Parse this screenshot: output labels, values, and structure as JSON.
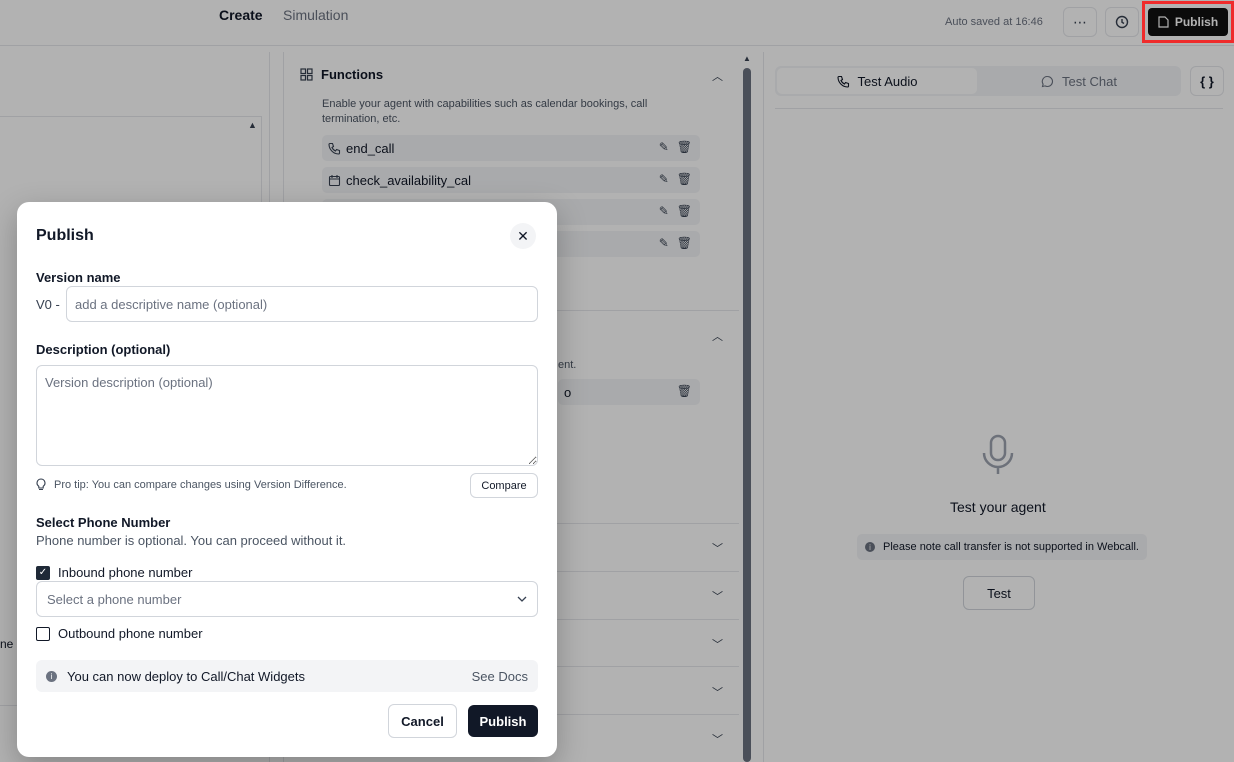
{
  "topbar": {
    "tab_create": "Create",
    "tab_simulation": "Simulation",
    "autosave": "Auto saved at 16:46",
    "more_icon": "ellipsis-icon",
    "history_icon": "history-icon",
    "publish_label": "Publish"
  },
  "left": {
    "fragment": "ne `"
  },
  "functions": {
    "title": "Functions",
    "description": "Enable your agent with capabilities such as calendar bookings, call termination, etc.",
    "items": [
      {
        "label": "end_call",
        "icon": "phone-icon"
      },
      {
        "label": "check_availability_cal",
        "icon": "calendar-icon"
      },
      {
        "label": "",
        "icon": ""
      },
      {
        "label": "",
        "icon": ""
      }
    ],
    "fragment_text": "ent.",
    "fragment_text2": "o"
  },
  "test_panel": {
    "tab_audio": "Test Audio",
    "tab_chat": "Test Chat",
    "json_label": "{ }",
    "heading": "Test your agent",
    "note": "Please note call transfer is not supported in Webcall.",
    "test_button": "Test"
  },
  "modal": {
    "title": "Publish",
    "version_label": "Version name",
    "version_prefix": "V0 -",
    "version_placeholder": "add a descriptive name (optional)",
    "description_label": "Description (optional)",
    "description_placeholder": "Version description (optional)",
    "tip": "Pro tip: You can compare changes using Version Difference.",
    "compare_button": "Compare",
    "phone_heading": "Select Phone Number",
    "phone_sub": "Phone number is optional. You can proceed without it.",
    "inbound_label": "Inbound phone number",
    "inbound_checked": true,
    "phone_select_placeholder": "Select a phone number",
    "outbound_label": "Outbound phone number",
    "outbound_checked": false,
    "deploy_text": "You can now deploy to Call/Chat Widgets",
    "see_docs": "See Docs",
    "cancel_button": "Cancel",
    "publish_button": "Publish"
  },
  "colors": {
    "primary_dark": "#111827",
    "highlight": "#ef2b2b",
    "muted_bg": "#f3f4f6"
  }
}
